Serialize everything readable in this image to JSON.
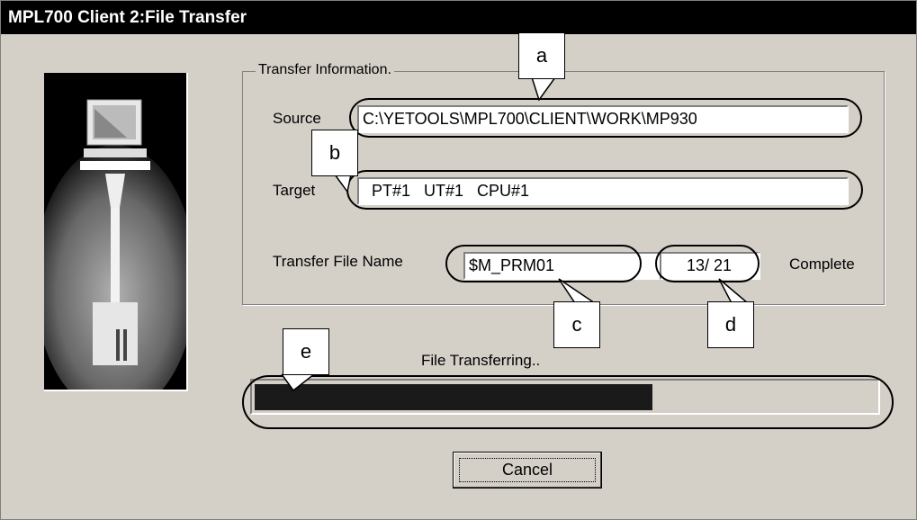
{
  "window": {
    "title": "MPL700 Client  2:File Transfer"
  },
  "group": {
    "title": "Transfer Information."
  },
  "source": {
    "label": "Source",
    "value": "C:\\YETOOLS\\MPL700\\CLIENT\\WORK\\MP930"
  },
  "target": {
    "label": "Target",
    "value": "  PT#1   UT#1   CPU#1"
  },
  "transfer_file": {
    "label": "Transfer File Name",
    "value": "$M_PRM01"
  },
  "count": {
    "value": "13/ 21",
    "label": "Complete"
  },
  "status": {
    "text": "File Transferring.."
  },
  "progress": {
    "fraction": 0.64
  },
  "buttons": {
    "cancel": "Cancel"
  },
  "callouts": [
    "a",
    "b",
    "c",
    "d",
    "e"
  ],
  "colors": {
    "titlebar": "#000000",
    "dialog": "#d4d0c8",
    "progress_fill": "#1a1a1a"
  },
  "icons": [
    "computer-transfer-illustration"
  ]
}
